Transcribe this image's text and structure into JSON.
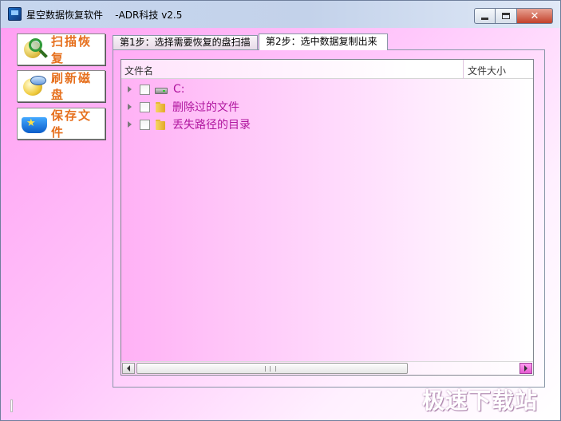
{
  "window": {
    "title": "星空数据恢复软件    -ADR科技 v2.5",
    "controls": {
      "minimize": "minimize",
      "maximize": "maximize",
      "close": "✕"
    }
  },
  "sidebar": {
    "buttons": [
      {
        "label": "扫描恢复",
        "icon": "magnifier-globe-icon"
      },
      {
        "label": "刷新磁盘",
        "icon": "refresh-disk-icon"
      },
      {
        "label": "保存文件",
        "icon": "save-pad-icon"
      }
    ]
  },
  "tabs": [
    {
      "label": "第1步：选择需要恢复的盘扫描",
      "active": false
    },
    {
      "label": "第2步：选中数据复制出来",
      "active": true
    }
  ],
  "file_list": {
    "columns": [
      "文件名",
      "文件大小"
    ],
    "rows": [
      {
        "label": "C:",
        "icon": "drive-icon",
        "checked": false
      },
      {
        "label": "删除过的文件",
        "icon": "folder-icon",
        "checked": false
      },
      {
        "label": "丢失路径的目录",
        "icon": "folder-icon",
        "checked": false
      }
    ]
  },
  "watermark": "极速下载站",
  "colors": {
    "accent_orange": "#e6701e",
    "tree_text": "#b0169e",
    "background_pink": "#ff9df2"
  }
}
